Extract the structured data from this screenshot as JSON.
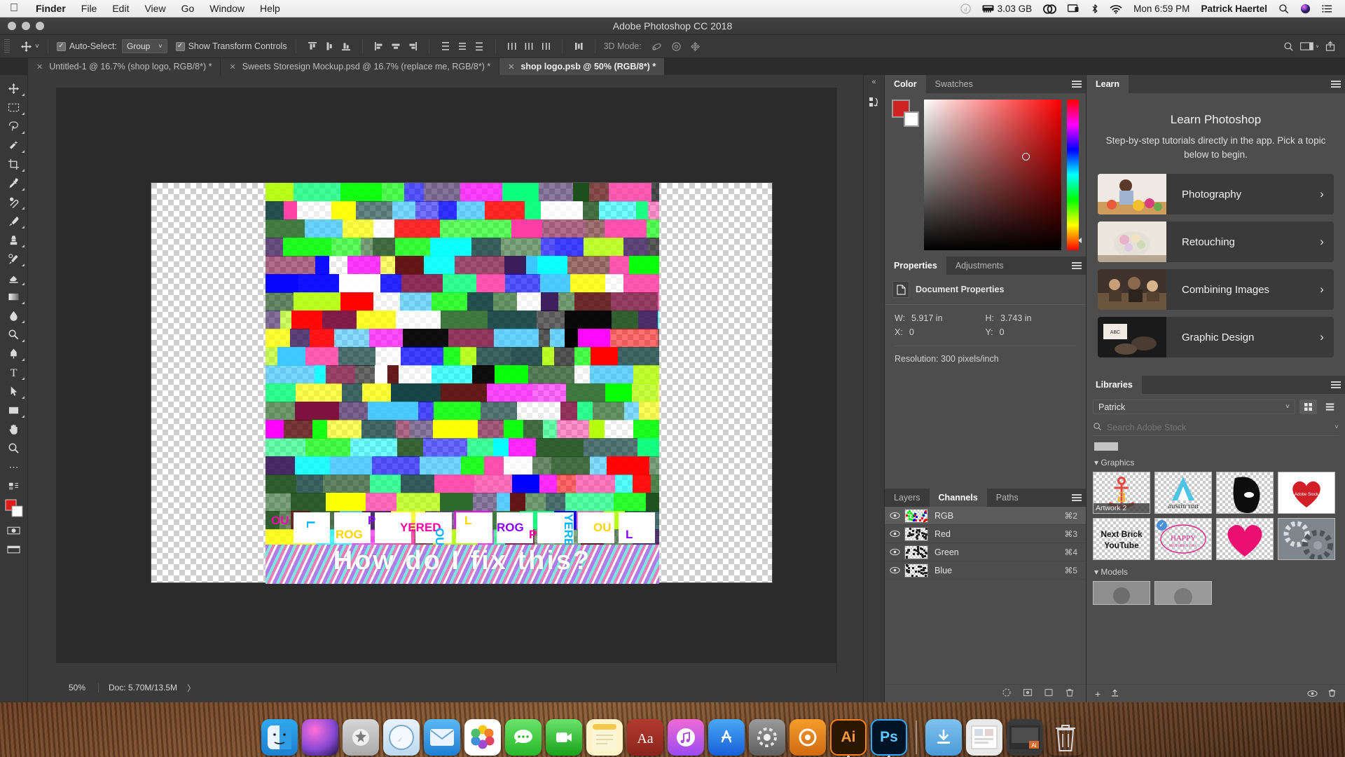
{
  "macmenu": {
    "apple": "apple-logo",
    "items": [
      "Finder",
      "File",
      "Edit",
      "View",
      "Go",
      "Window",
      "Help"
    ],
    "status": {
      "dropbox": "d",
      "memory": "3.03 GB",
      "creative_cloud": "cc-icon",
      "display": "display-icon",
      "bluetooth": "bluetooth-icon",
      "wifi": "wifi-icon",
      "clock": "Mon 6:59 PM",
      "user": "Patrick Haertel",
      "search": "search-icon",
      "siri": "siri-icon",
      "notification": "notification-center-icon"
    }
  },
  "window": {
    "title": "Adobe Photoshop CC 2018"
  },
  "options_bar": {
    "tool_icon": "move-tool",
    "auto_select_checked": true,
    "auto_select_label": "Auto-Select:",
    "auto_select_value": "Group",
    "show_transform_checked": true,
    "show_transform_label": "Show Transform Controls",
    "three_d_label": "3D Mode:",
    "align_icons": [
      "align-top-edges",
      "align-vertical-centers",
      "align-bottom-edges",
      "align-left-edges",
      "align-horizontal-centers",
      "align-right-edges",
      "distribute-top-edges",
      "distribute-vertical-centers",
      "distribute-bottom-edges",
      "distribute-left-edges",
      "distribute-horizontal-centers",
      "distribute-right-edges",
      "distribute-spacing"
    ],
    "three_d_icons": [
      "3d-orbit",
      "3d-roll",
      "3d-pan",
      "3d-slide"
    ],
    "right_icons": [
      "search-icon",
      "workspace-icon",
      "share-icon"
    ]
  },
  "document_tabs": [
    {
      "label": "Untitled-1 @ 16.7% (shop logo, RGB/8*) *",
      "active": false
    },
    {
      "label": "Sweets Storesign Mockup.psd @ 16.7% (replace me, RGB/8*) *",
      "active": false
    },
    {
      "label": "shop logo.psb @ 50% (RGB/8*) *",
      "active": true
    }
  ],
  "toolbar": {
    "tools": [
      "move-tool",
      "rectangular-marquee-tool",
      "lasso-tool",
      "quick-selection-tool",
      "crop-tool",
      "eyedropper-tool",
      "spot-healing-brush-tool",
      "brush-tool",
      "clone-stamp-tool",
      "history-brush-tool",
      "eraser-tool",
      "gradient-tool",
      "blur-tool",
      "dodge-tool",
      "pen-tool",
      "type-tool",
      "path-selection-tool",
      "rectangle-tool",
      "hand-tool",
      "zoom-tool",
      "more-tools",
      "edit-toolbar",
      "foreground-background-colors",
      "quick-mask-mode",
      "screen-mode"
    ]
  },
  "canvas": {
    "artwork_text": "How do I fix this?",
    "glitch_fragment_words": [
      "OU",
      "L",
      "ROG",
      "P",
      "YERED"
    ],
    "zoom": "50%",
    "doc_size": "Doc: 5.70M/13.5M",
    "status_arrow": "〉"
  },
  "color_panel": {
    "tabs": [
      {
        "label": "Color",
        "active": true
      },
      {
        "label": "Swatches",
        "active": false
      }
    ],
    "foreground_color": "#cf2222",
    "background_color": "#ffffff",
    "menu_icon": "panel-menu-icon"
  },
  "properties_panel": {
    "tabs": [
      {
        "label": "Properties",
        "active": true
      },
      {
        "label": "Adjustments",
        "active": false
      }
    ],
    "header": "Document Properties",
    "header_icon": "document-icon",
    "fields": [
      {
        "key": "W:",
        "value": "5.917 in"
      },
      {
        "key": "H:",
        "value": "3.743 in"
      },
      {
        "key": "X:",
        "value": "0"
      },
      {
        "key": "Y:",
        "value": "0"
      }
    ],
    "resolution": "Resolution: 300 pixels/inch",
    "menu_icon": "panel-menu-icon"
  },
  "channels_panel": {
    "tabs": [
      {
        "label": "Layers",
        "active": false
      },
      {
        "label": "Channels",
        "active": true
      },
      {
        "label": "Paths",
        "active": false
      }
    ],
    "channels": [
      {
        "name": "RGB",
        "shortcut": "⌘2",
        "selected": true,
        "visible": true
      },
      {
        "name": "Red",
        "shortcut": "⌘3",
        "selected": false,
        "visible": true
      },
      {
        "name": "Green",
        "shortcut": "⌘4",
        "selected": false,
        "visible": true
      },
      {
        "name": "Blue",
        "shortcut": "⌘5",
        "selected": false,
        "visible": true
      }
    ],
    "footer_icons": [
      "load-channel-as-selection",
      "save-selection-as-channel",
      "create-new-channel",
      "delete-channel"
    ],
    "menu_icon": "panel-menu-icon"
  },
  "learn_panel": {
    "tab": "Learn",
    "title": "Learn Photoshop",
    "subtitle": "Step-by-step tutorials directly in the app. Pick a topic below to begin.",
    "cards": [
      {
        "label": "Photography",
        "thumb": "woman-arranging-flowers"
      },
      {
        "label": "Retouching",
        "thumb": "flower-bouquet"
      },
      {
        "label": "Combining Images",
        "thumb": "people-at-table"
      },
      {
        "label": "Graphic Design",
        "thumb": "hands-on-dark-desk"
      }
    ],
    "chevron": "›",
    "menu_icon": "panel-menu-icon"
  },
  "libraries_panel": {
    "tab": "Libraries",
    "selected_library": "Patrick",
    "search_placeholder": "Search Adobe Stock",
    "search_icon": "search-icon",
    "view_grid_icon": "grid-view-icon",
    "view_list_icon": "list-view-icon",
    "sections": [
      {
        "title": "Graphics",
        "items": [
          {
            "caption": "Artwork 2",
            "thumb": "anchor-monogram"
          },
          {
            "caption": "",
            "thumb": "austin-run-letter-a"
          },
          {
            "caption": "",
            "thumb": "high-contrast-portrait"
          },
          {
            "caption": "",
            "thumb": "red-heart-adobe-stock"
          },
          {
            "caption": "",
            "thumb": "next-brick-youtube-text"
          },
          {
            "caption": "",
            "thumb": "happy-mothers-day-badge",
            "checked": true
          },
          {
            "caption": "",
            "thumb": "pink-heart"
          },
          {
            "caption": "",
            "thumb": "gears-photo"
          }
        ]
      },
      {
        "title": "Models",
        "items": [
          {
            "caption": "",
            "thumb": "model-photo-1"
          },
          {
            "caption": "",
            "thumb": "model-photo-2"
          }
        ]
      }
    ],
    "footer_icons": [
      "add-content-icon",
      "upload-icon",
      "show-hidden-icon",
      "delete-icon"
    ],
    "menu_icon": "panel-menu-icon"
  },
  "dock": {
    "items": [
      "finder",
      "siri",
      "launchpad",
      "safari",
      "mail",
      "photos",
      "messages",
      "facetime",
      "notes",
      "dictionary",
      "itunes",
      "app-store",
      "system-preferences",
      "handbrake",
      "adobe-illustrator",
      "adobe-photoshop",
      "downloads-folder",
      "documents-stack",
      "screenshot-preview",
      "trash"
    ]
  }
}
